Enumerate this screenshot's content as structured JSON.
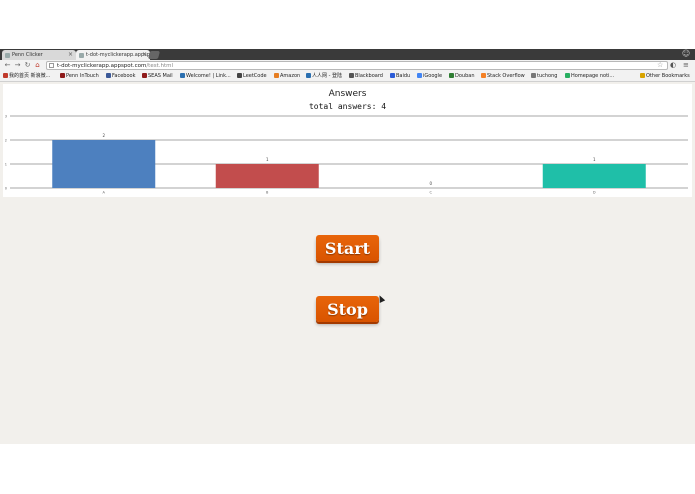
{
  "browser": {
    "tabs": [
      {
        "title": "Penn Clicker",
        "active": false
      },
      {
        "title": "t-dot-myclickerapp.appsp",
        "active": true
      }
    ],
    "address": {
      "host": "t-dot-myclickerapp.appspot.com",
      "path": "/test.html"
    },
    "bookmarks": [
      "我的首页 新浪微...",
      "Penn InTouch",
      "Facebook",
      "SEAS Mail",
      "Welcome! | Link...",
      "LeetCode",
      "Amazon",
      "人人网 - 登陆",
      "Blackboard",
      "Baidu",
      "iGoogle",
      "Douban",
      "Stack Overflow",
      "tuchong",
      "Homepage noti...",
      "Other Bookmarks"
    ],
    "bookmark_icon_colors": [
      "#c0392b",
      "#8e1a1a",
      "#3b5998",
      "#8e1a1a",
      "#2a6fb0",
      "#444",
      "#e67e22",
      "#2a6fb0",
      "#555",
      "#2a5bd7",
      "#4285f4",
      "#2e7d32",
      "#f48024",
      "#777",
      "#27ae60",
      "#d9a400"
    ]
  },
  "chart_data": {
    "type": "bar",
    "title": "Answers",
    "subtitle": "total answers: 4",
    "categories": [
      "A",
      "B",
      "C",
      "D"
    ],
    "values": [
      2,
      1,
      0,
      1
    ],
    "colors": [
      "#4d80bf",
      "#c24d4d",
      "#999999",
      "#1fbfa8"
    ],
    "ylim": [
      0,
      3
    ],
    "yticks": [
      "0",
      "1",
      "2",
      "3"
    ],
    "grid": true
  },
  "controls": {
    "start_label": "Start",
    "stop_label": "Stop"
  }
}
